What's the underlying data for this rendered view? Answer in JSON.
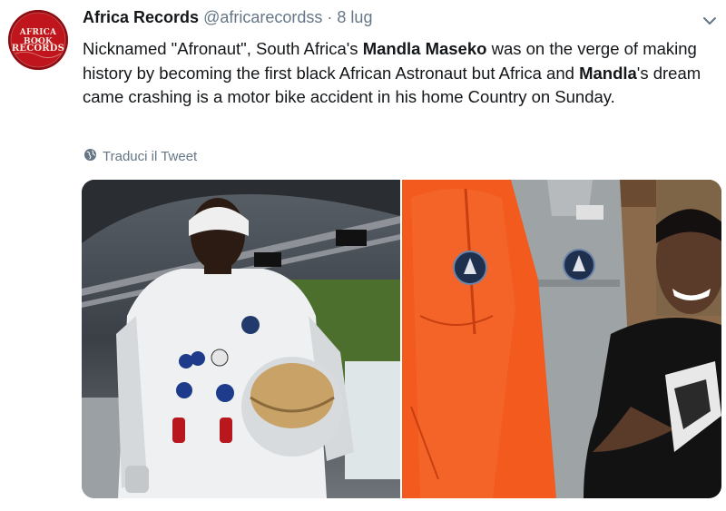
{
  "tweet": {
    "author_name": "Africa Records",
    "author_handle": "@africarecordss",
    "separator": "·",
    "date": "8 lug",
    "avatar_text": {
      "line1": "AFRICA BOOK",
      "line2": "&",
      "line3": "RECORDS"
    },
    "text_parts": [
      {
        "t": "Nicknamed \"Afronaut\", South Africa's ",
        "bold": false
      },
      {
        "t": "Mandla Maseko",
        "bold": true
      },
      {
        "t": " was on the verge of making history by becoming the first black African Astronaut but Africa and ",
        "bold": false
      },
      {
        "t": "Mandla",
        "bold": true
      },
      {
        "t": "'s dream came crashing is a motor bike accident in his home Country on Sunday.",
        "bold": false
      }
    ],
    "translate_label": "Traduci il Tweet"
  },
  "icons": {
    "caret": "chevron-down-icon",
    "translate": "globe-icon"
  },
  "colors": {
    "text": "#14171a",
    "muted": "#657786",
    "avatar_red": "#c0151d",
    "suit_orange": "#f25a1e"
  }
}
